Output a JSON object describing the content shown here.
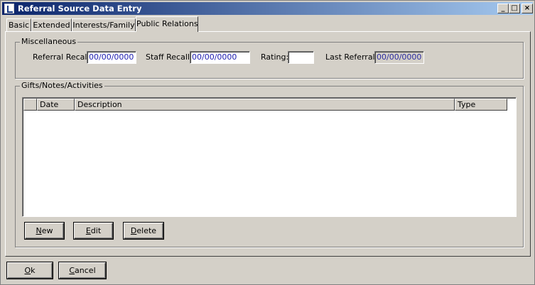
{
  "window": {
    "title": "Referral Source Data Entry",
    "controls": {
      "minimize": "_",
      "maximize": "□",
      "close": "×"
    }
  },
  "tabs": [
    {
      "label": "Basic",
      "active": false
    },
    {
      "label": "Extended",
      "active": false
    },
    {
      "label": "Interests/Family",
      "active": false
    },
    {
      "label": "Public Relations",
      "active": true
    }
  ],
  "miscellaneous": {
    "group_label": "Miscellaneous",
    "referral_recall": {
      "label": "Referral Recall:",
      "value": "00/00/0000"
    },
    "staff_recall": {
      "label": "Staff Recall:",
      "value": "00/00/0000"
    },
    "rating": {
      "label": "Rating:",
      "value": ""
    },
    "last_referral": {
      "label": "Last Referral:",
      "value": "00/00/0000"
    }
  },
  "gifts": {
    "group_label": "Gifts/Notes/Activities",
    "columns": [
      "",
      "Date",
      "Description",
      "Type"
    ],
    "rows": [],
    "buttons": {
      "new": {
        "mnemonic": "N",
        "rest": "ew"
      },
      "edit": {
        "mnemonic": "E",
        "rest": "dit"
      },
      "delete": {
        "mnemonic": "D",
        "rest": "elete"
      }
    }
  },
  "footer_buttons": {
    "ok": {
      "mnemonic": "O",
      "rest": "k"
    },
    "cancel": {
      "mnemonic": "C",
      "rest": "ancel"
    }
  }
}
